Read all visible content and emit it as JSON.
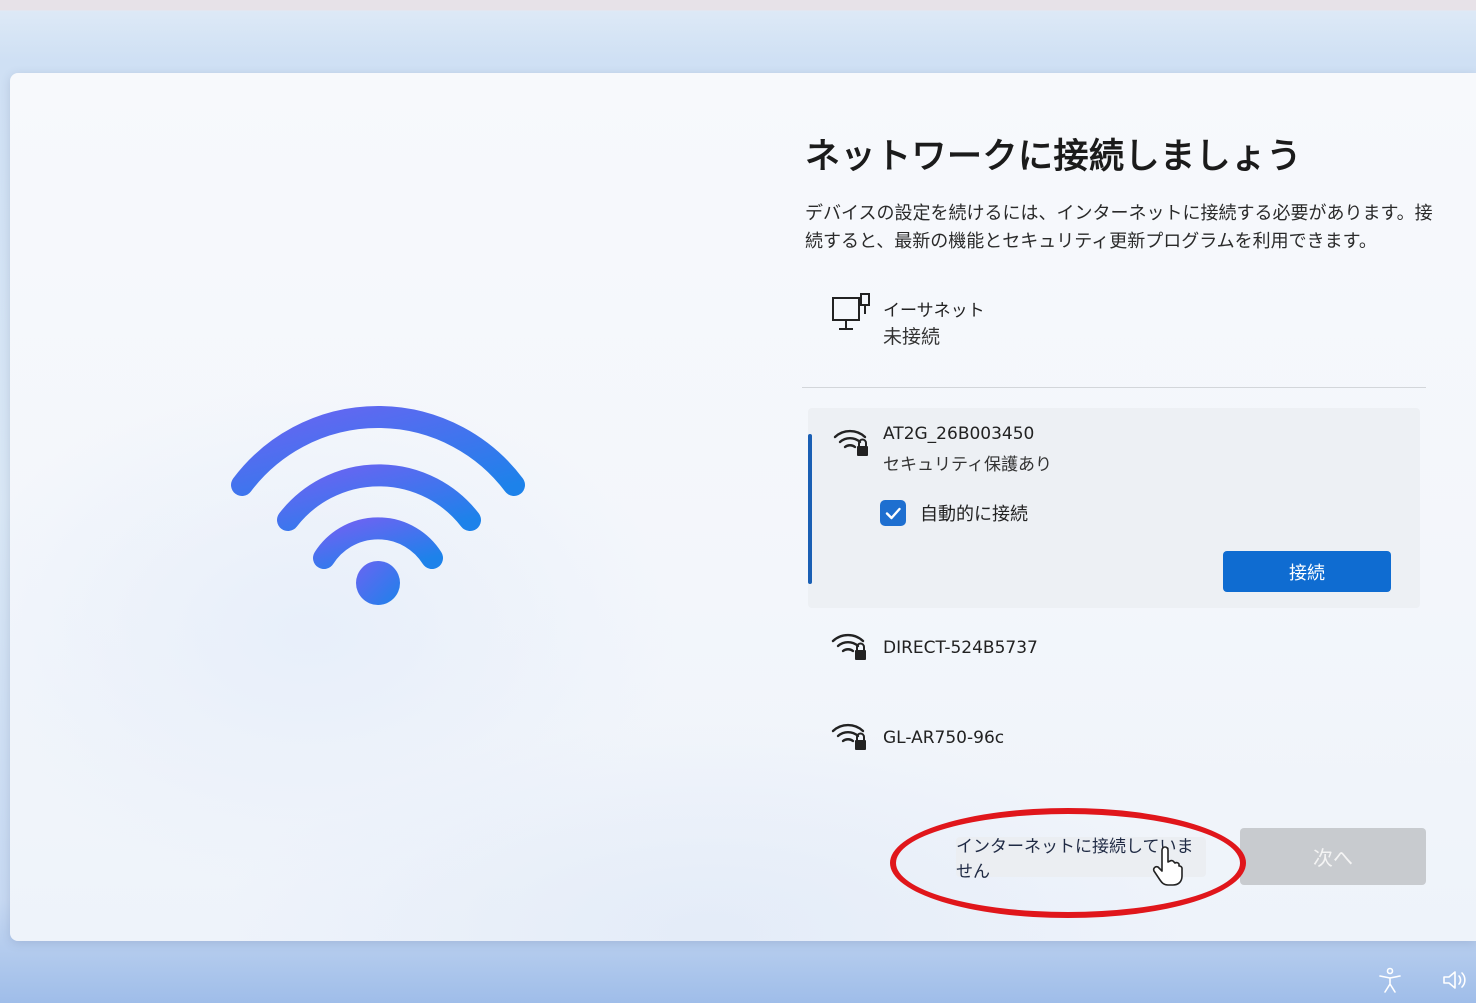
{
  "page": {
    "title": "ネットワークに接続しましょう",
    "description": "デバイスの設定を続けるには、インターネットに接続する必要があります。接続すると、最新の機能とセキュリティ更新プログラムを利用できます。"
  },
  "ethernet": {
    "icon": "ethernet-monitor-icon",
    "name": "イーサネット",
    "status": "未接続"
  },
  "networks": [
    {
      "icon": "wifi-lock-icon",
      "name": "AT2G_26B003450",
      "security": "セキュリティ保護あり",
      "auto_connect_label": "自動的に接続",
      "auto_connect_checked": true,
      "connect_label": "接続",
      "selected": true
    },
    {
      "icon": "wifi-lock-icon",
      "name": "DIRECT-524B5737"
    },
    {
      "icon": "wifi-lock-icon",
      "name": "GL-AR750-96c"
    }
  ],
  "footer": {
    "offline_label": "インターネットに接続していません",
    "next_label": "次へ",
    "next_enabled": false
  },
  "tray": {
    "accessibility_icon": "accessibility-icon",
    "volume_icon": "volume-icon"
  },
  "colors": {
    "accent": "#0f6cd1",
    "highlight_ellipse": "#e0161b",
    "wifi_gradient_start": "#5b6cf0",
    "wifi_gradient_end": "#1f7cea"
  }
}
